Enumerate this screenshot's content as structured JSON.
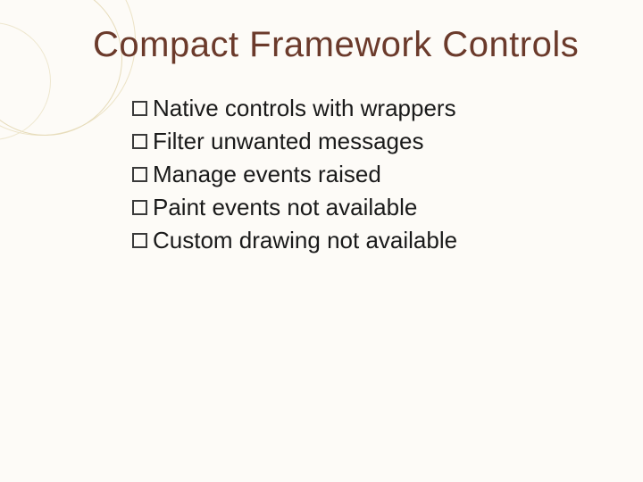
{
  "title": "Compact Framework Controls",
  "bullets": [
    {
      "text": "Native controls with wrappers"
    },
    {
      "text": "Filter unwanted messages"
    },
    {
      "text": "Manage events raised"
    },
    {
      "text": "Paint events not available"
    },
    {
      "text": "Custom drawing not available"
    }
  ]
}
